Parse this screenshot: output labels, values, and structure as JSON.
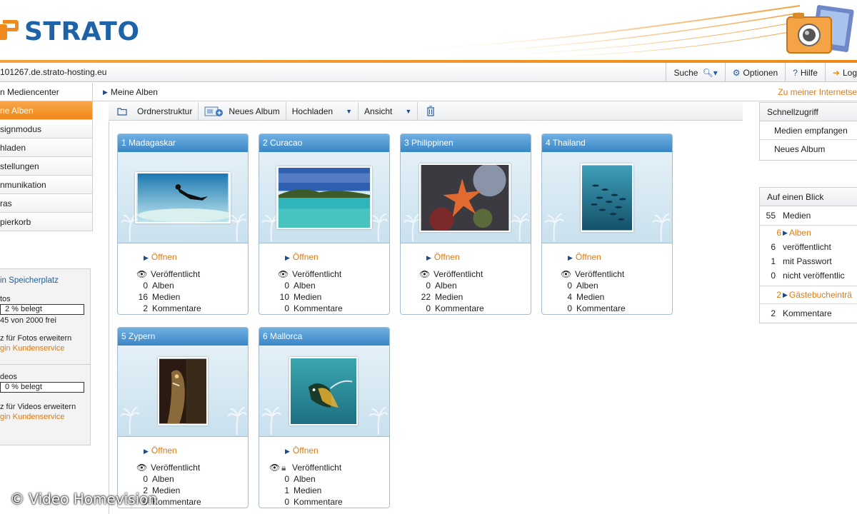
{
  "brand": {
    "name": "STRATO",
    "color": "#1e63a8",
    "accent": "#ef8a16"
  },
  "topbar": {
    "domain": "101267.de.strato-hosting.eu",
    "search_label": "Suche",
    "options_label": "Optionen",
    "help_label": "Hilfe",
    "logout_label": "Log"
  },
  "sidebar": {
    "header": "n Mediencenter",
    "items": [
      {
        "label": "ne Alben",
        "active": true
      },
      {
        "label": "signmodus"
      },
      {
        "label": "hladen"
      },
      {
        "label": "stellungen"
      },
      {
        "label": "nmunikation"
      },
      {
        "label": "ras"
      },
      {
        "label": "pierkorb"
      }
    ],
    "storage": {
      "title": "in Speicherplatz",
      "photos_label": "tos",
      "photos_usage": "2 % belegt",
      "photos_free": "45 von 2000 frei",
      "photos_extend": "z für Fotos erweitern",
      "photos_service": "gin Kundenservice",
      "videos_label": "deos",
      "videos_usage": "0 % belegt",
      "videos_extend": "z für Videos erweitern",
      "videos_service": "gin Kundenservice"
    }
  },
  "breadcrumb": {
    "current": "Meine Alben"
  },
  "right_link": "Zu meiner Internetse",
  "toolbar": {
    "folder_structure": "Ordnerstruktur",
    "new_album": "Neues Album",
    "upload": "Hochladen",
    "view": "Ansicht"
  },
  "albums": [
    {
      "title": "1 Madagaskar",
      "open": "Öffnen",
      "status": "Veröffentlicht",
      "albums_n": "0",
      "albums_label": "Alben",
      "media_n": "16",
      "media_label": "Medien",
      "comments_n": "2",
      "comments_label": "Kommentare",
      "thumb": "diver-underwater"
    },
    {
      "title": "2 Curacao",
      "open": "Öffnen",
      "status": "Veröffentlicht",
      "albums_n": "0",
      "albums_label": "Alben",
      "media_n": "10",
      "media_label": "Medien",
      "comments_n": "0",
      "comments_label": "Kommentare",
      "thumb": "island-lagoon"
    },
    {
      "title": "3 Philippinen",
      "open": "Öffnen",
      "status": "Veröffentlicht",
      "albums_n": "0",
      "albums_label": "Alben",
      "media_n": "22",
      "media_label": "Medien",
      "comments_n": "0",
      "comments_label": "Kommentare",
      "thumb": "starfish-reef"
    },
    {
      "title": "4 Thailand",
      "open": "Öffnen",
      "status": "Veröffentlicht",
      "albums_n": "0",
      "albums_label": "Alben",
      "media_n": "4",
      "media_label": "Medien",
      "comments_n": "0",
      "comments_label": "Kommentare",
      "thumb": "fish-school"
    },
    {
      "title": "5 Zypern",
      "open": "Öffnen",
      "status": "Veröffentlicht",
      "albums_n": "0",
      "albums_label": "Alben",
      "media_n": "2",
      "media_label": "Medien",
      "comments_n": "0",
      "comments_label": "Kommentare",
      "thumb": "moray-eel"
    },
    {
      "title": "6 Mallorca",
      "open": "Öffnen",
      "status": "Veröffentlicht",
      "albums_n": "0",
      "albums_label": "Alben",
      "media_n": "1",
      "media_label": "Medien",
      "comments_n": "0",
      "comments_label": "Kommentare",
      "thumb": "reef-fish"
    }
  ],
  "quick_access": {
    "title": "Schnellzugriff",
    "receive_media": "Medien empfangen",
    "new_album": "Neues Album"
  },
  "overview": {
    "title": "Auf einen Blick",
    "media_n": "55",
    "media_label": "Medien",
    "albums_n": "6",
    "albums_label": "Alben",
    "published_n": "6",
    "published_label": "veröffentlicht",
    "password_n": "1",
    "password_label": "mit Passwort",
    "unpublished_n": "0",
    "unpublished_label": "nicht veröffentlic",
    "guestbook_n": "2",
    "guestbook_label": "Gästebucheinträ",
    "comments_n": "2",
    "comments_label": "Kommentare"
  },
  "watermark": "© Video Homevision"
}
